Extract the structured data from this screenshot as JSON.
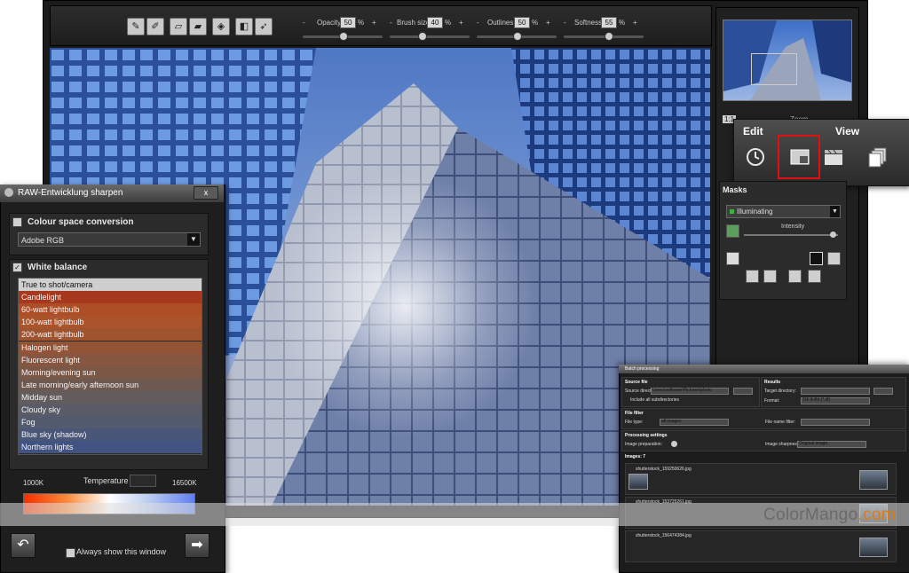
{
  "toolbar": {
    "sliders": [
      {
        "label": "Opacity",
        "value": "50",
        "unit": "%",
        "fraction": 0.5
      },
      {
        "label": "Brush size",
        "value": "40",
        "unit": "%",
        "fraction": 0.4
      },
      {
        "label": "Outlines",
        "value": "50",
        "unit": "%",
        "fraction": 0.5
      },
      {
        "label": "Softness",
        "value": "55",
        "unit": "%",
        "fraction": 0.55
      }
    ],
    "minus": "-",
    "plus": "+"
  },
  "navigator": {
    "zoom_prefix": "1:1",
    "zoom_label": "Zoom"
  },
  "popup": {
    "edit_label": "Edit",
    "view_label": "View",
    "icons": [
      "history-icon",
      "window-icon",
      "clapperboard-icon",
      "stack-icon"
    ]
  },
  "masks": {
    "title": "Masks",
    "selected": "Illuminating",
    "intensity_label": "Intensity",
    "intensity_fraction": 0.95
  },
  "raw_dialog": {
    "title": "RAW-Entwicklung sharpen",
    "close": "x",
    "colour_space_label": "Colour space conversion",
    "colour_space_value": "Adobe RGB",
    "colour_space_checked": false,
    "white_balance_label": "White balance",
    "white_balance_checked": true,
    "white_balance_options": [
      {
        "label": "True to shot/camera",
        "color": "#cfcfcf",
        "text": "#111111"
      },
      {
        "label": "Candlelight",
        "color": "#a6391d",
        "text": "#f4f4f4"
      },
      {
        "label": "60-watt lightbulb",
        "color": "#ad4e26",
        "text": "#f4f4f4"
      },
      {
        "label": "100-watt lightbulb",
        "color": "#ab532a",
        "text": "#f4f4f4"
      },
      {
        "label": "200-watt lightbulb",
        "color": "#9f5430",
        "text": "#f4f4f4"
      },
      {
        "label": "Halogen light",
        "color": "#925337",
        "text": "#f4f4f4"
      },
      {
        "label": "Fluorescent light",
        "color": "#875640",
        "text": "#f4f4f4"
      },
      {
        "label": "Morning/evening sun",
        "color": "#7b5746",
        "text": "#f4f4f4"
      },
      {
        "label": "Late morning/early afternoon sun",
        "color": "#6d5950",
        "text": "#f4f4f4"
      },
      {
        "label": "Midday sun",
        "color": "#625c5c",
        "text": "#f4f4f4"
      },
      {
        "label": "Cloudy sky",
        "color": "#595c66",
        "text": "#f4f4f4"
      },
      {
        "label": "Fog",
        "color": "#525a6e",
        "text": "#f4f4f4"
      },
      {
        "label": "Blue sky (shadow)",
        "color": "#4a5677",
        "text": "#f4f4f4"
      },
      {
        "label": "Northern lights",
        "color": "#425381",
        "text": "#f4f4f4"
      }
    ],
    "temperature_label": "Temperature",
    "temperature_min": "1000K",
    "temperature_max": "16500K",
    "always_show_label": "Always show this window",
    "back_icon": "undo-arrow-icon",
    "forward_icon": "right-arrow-icon"
  },
  "batch": {
    "title": "Batch processing",
    "source_file": "Source file",
    "source_dir_label": "Source directory:",
    "source_dir_value": "Users\\software\\Pictures\\photo",
    "include_sub": "Include all subdirectories",
    "results": "Results",
    "target_dir_label": "Target directory:",
    "format_label": "Format:",
    "format_value": "TIF 8-Bit (*.tif)",
    "file_filter": "File filter",
    "file_type_label": "File type:",
    "file_type_value": "all images",
    "file_name_filter_label": "File name filter:",
    "processing_settings": "Processing settings",
    "image_preparation_label": "Image preparation:",
    "image_sharpness_label": "Image sharpness:",
    "image_sharpness_value": "Original image",
    "images_label": "Images: 7",
    "images": [
      "shutterstock_159250626.jpg",
      "shutterstock_153725261.jpg",
      "shutterstock_156474384.jpg"
    ]
  },
  "watermark": {
    "text_main": "ColorMango",
    "text_tail": ".com"
  }
}
